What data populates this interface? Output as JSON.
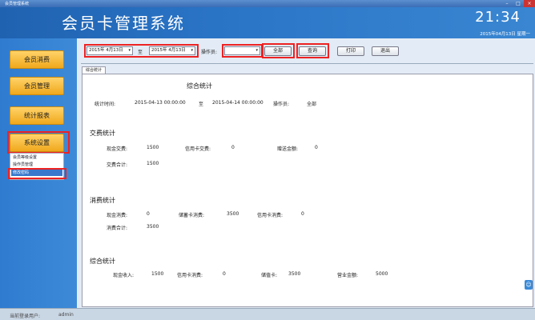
{
  "window": {
    "title": "会员管理系统",
    "controls": [
      "–",
      "□",
      "×"
    ]
  },
  "header": {
    "app_title": "会员卡管理系统",
    "clock": "21:34",
    "date": "2015年04月13日  星期一"
  },
  "sidebar": {
    "items": [
      {
        "label": "会员消费"
      },
      {
        "label": "会员管理"
      },
      {
        "label": "统计报表"
      },
      {
        "label": "系统设置"
      }
    ],
    "submenu": [
      {
        "label": "会员等级设置"
      },
      {
        "label": "操作员管理"
      },
      {
        "label": "修改密码"
      }
    ]
  },
  "toolbar": {
    "start_date": "2015年 4月13日",
    "date_sep": "至",
    "end_date": "2015年 4月13日",
    "operator_label": "操作员:",
    "operator_value": "",
    "buttons": {
      "all": "全部",
      "query": "查询",
      "print": "打印",
      "exit": "退出"
    }
  },
  "tab": {
    "label": "综合统计"
  },
  "report": {
    "title": "综合统计",
    "period_label": "统计时间:",
    "period_start": "2015-04-13 00:00:00",
    "period_sep": "至",
    "period_end": "2015-04-14 00:00:00",
    "operator_label": "操作员:",
    "operator_value": "全部",
    "recharge": {
      "heading": "交费统计",
      "cash_label": "现金交费:",
      "cash_value": "1500",
      "card_label": "信用卡交费:",
      "card_value": "0",
      "gift_label": "赠送金额:",
      "gift_value": "0",
      "total_label": "交费合计:",
      "total_value": "1500"
    },
    "consume": {
      "heading": "消费统计",
      "cash_label": "现金消费:",
      "cash_value": "0",
      "stored_label": "储蓄卡消费:",
      "stored_value": "3500",
      "card_label": "信用卡消费:",
      "card_value": "0",
      "total_label": "消费合计:",
      "total_value": "3500"
    },
    "summary": {
      "heading": "综合统计",
      "cash_label": "现金收入:",
      "cash_value": "1500",
      "card_label": "信用卡消费:",
      "card_value": "0",
      "stored_label": "储值卡:",
      "stored_value": "3500",
      "revenue_label": "营业金额:",
      "revenue_value": "5000"
    }
  },
  "status": {
    "user_label": "当前登录用户:",
    "user_value": "admin"
  }
}
